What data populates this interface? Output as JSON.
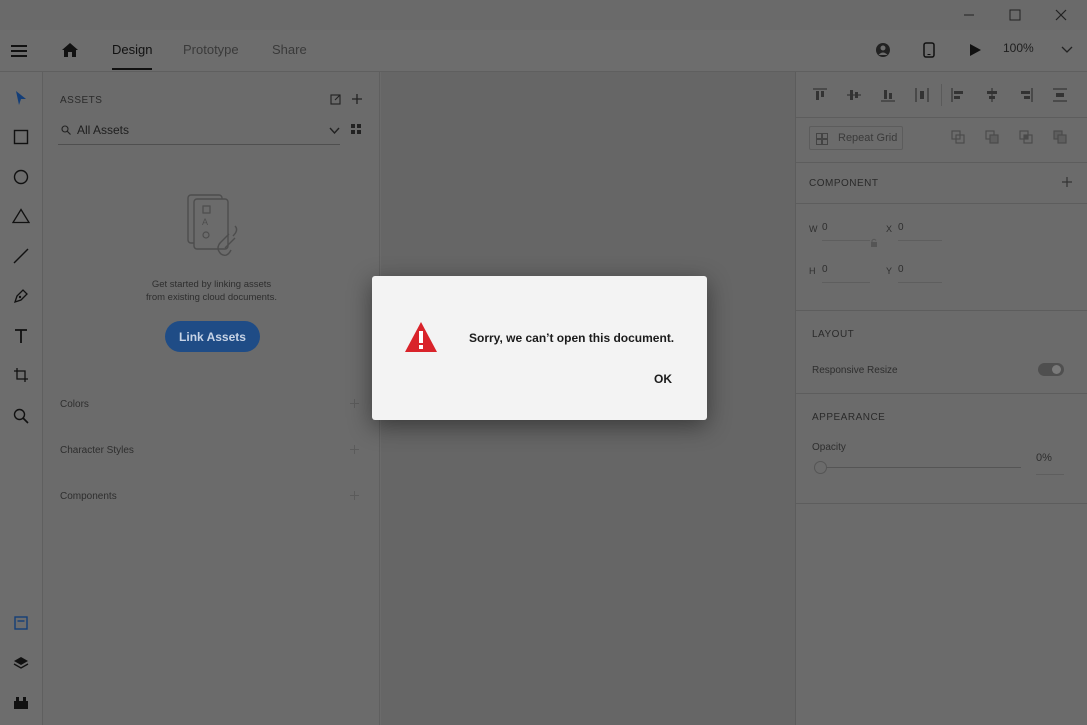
{
  "window": {
    "minimize_icon": "minimize-icon",
    "maximize_icon": "maximize-icon",
    "close_icon": "close-icon"
  },
  "topbar": {
    "tabs": [
      {
        "label": "Design",
        "active": true
      },
      {
        "label": "Prototype",
        "active": false
      },
      {
        "label": "Share",
        "active": false
      }
    ],
    "zoom": "100%"
  },
  "assets": {
    "title": "ASSETS",
    "search_value": "All Assets",
    "empty_line1": "Get started by linking assets",
    "empty_line2": "from existing cloud documents.",
    "link_button": "Link Assets",
    "sections": [
      "Colors",
      "Character Styles",
      "Components"
    ]
  },
  "props": {
    "repeat_grid": "Repeat Grid",
    "component_title": "COMPONENT",
    "w_label": "W",
    "w_value": "0",
    "x_label": "X",
    "x_value": "0",
    "h_label": "H",
    "h_value": "0",
    "y_label": "Y",
    "y_value": "0",
    "layout_title": "LAYOUT",
    "responsive_resize": "Responsive Resize",
    "appearance_title": "APPEARANCE",
    "opacity_label": "Opacity",
    "opacity_value": "0%"
  },
  "dialog": {
    "message": "Sorry, we can’t open this document.",
    "ok_label": "OK"
  },
  "colors": {
    "dialog_bg": "#f3f3f3",
    "warning": "#d9232a",
    "accent": "#1f4c86"
  }
}
